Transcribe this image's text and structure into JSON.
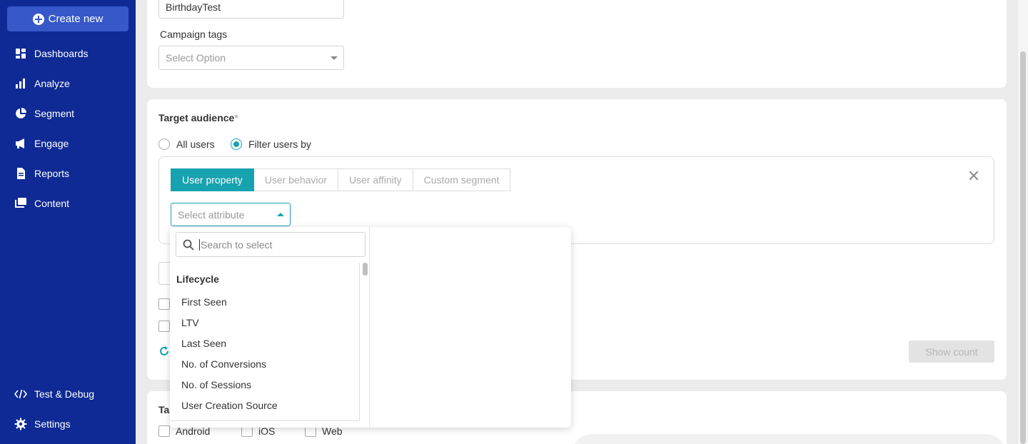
{
  "sidebar": {
    "create_label": "Create new",
    "items": [
      {
        "label": "Dashboards",
        "icon": "dashboard-icon"
      },
      {
        "label": "Analyze",
        "icon": "bar-chart-icon"
      },
      {
        "label": "Segment",
        "icon": "pie-chart-icon"
      },
      {
        "label": "Engage",
        "icon": "megaphone-icon"
      },
      {
        "label": "Reports",
        "icon": "document-icon"
      },
      {
        "label": "Content",
        "icon": "content-stack-icon"
      }
    ],
    "bottom_items": [
      {
        "label": "Test & Debug",
        "icon": "code-icon"
      },
      {
        "label": "Settings",
        "icon": "gear-icon"
      }
    ]
  },
  "campaign": {
    "name_value": "BirthdayTest",
    "tags_label": "Campaign tags",
    "tags_placeholder": "Select Option"
  },
  "audience": {
    "title": "Target audience",
    "required_mark": "*",
    "options": [
      "All users",
      "Filter users by"
    ],
    "selected_option": "Filter users by",
    "tabs": [
      "User property",
      "User behavior",
      "User affinity",
      "Custom segment"
    ],
    "active_tab": "User property",
    "attribute_placeholder": "Select attribute",
    "show_count_label": "Show count"
  },
  "dropdown": {
    "search_placeholder": "Search to select",
    "group": "Lifecycle",
    "items": [
      "First Seen",
      "LTV",
      "Last Seen",
      "No. of Conversions",
      "No. of Sessions",
      "User Creation Source"
    ]
  },
  "platforms": {
    "title_partial": "Ta",
    "items": [
      "Android",
      "iOS",
      "Web"
    ]
  },
  "colors": {
    "sidebar": "#0f2a94",
    "primary_button": "#3658c9",
    "accent": "#17a2b0"
  }
}
